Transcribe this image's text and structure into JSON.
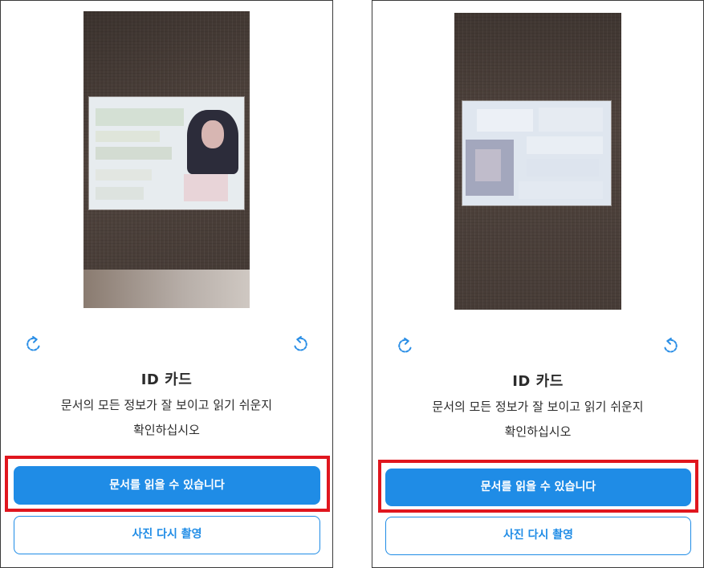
{
  "screens": [
    {
      "title": "ID 카드",
      "description_line1": "문서의 모든 정보가 잘 보이고 읽기 쉬운지",
      "description_line2": "확인하십시오",
      "primary_button": "문서를 읽을 수 있습니다",
      "secondary_button": "사진 다시 촬영"
    },
    {
      "title": "ID 카드",
      "description_line1": "문서의 모든 정보가 잘 보이고 읽기 쉬운지",
      "description_line2": "확인하십시오",
      "primary_button": "문서를 읽을 수 있습니다",
      "secondary_button": "사진 다시 촬영"
    }
  ],
  "colors": {
    "accent": "#1f8ce6",
    "highlight": "#e0161e",
    "text": "#2b2b2b"
  },
  "icons": {
    "rotate_left": "rotate-left-icon",
    "rotate_right": "rotate-right-icon"
  }
}
